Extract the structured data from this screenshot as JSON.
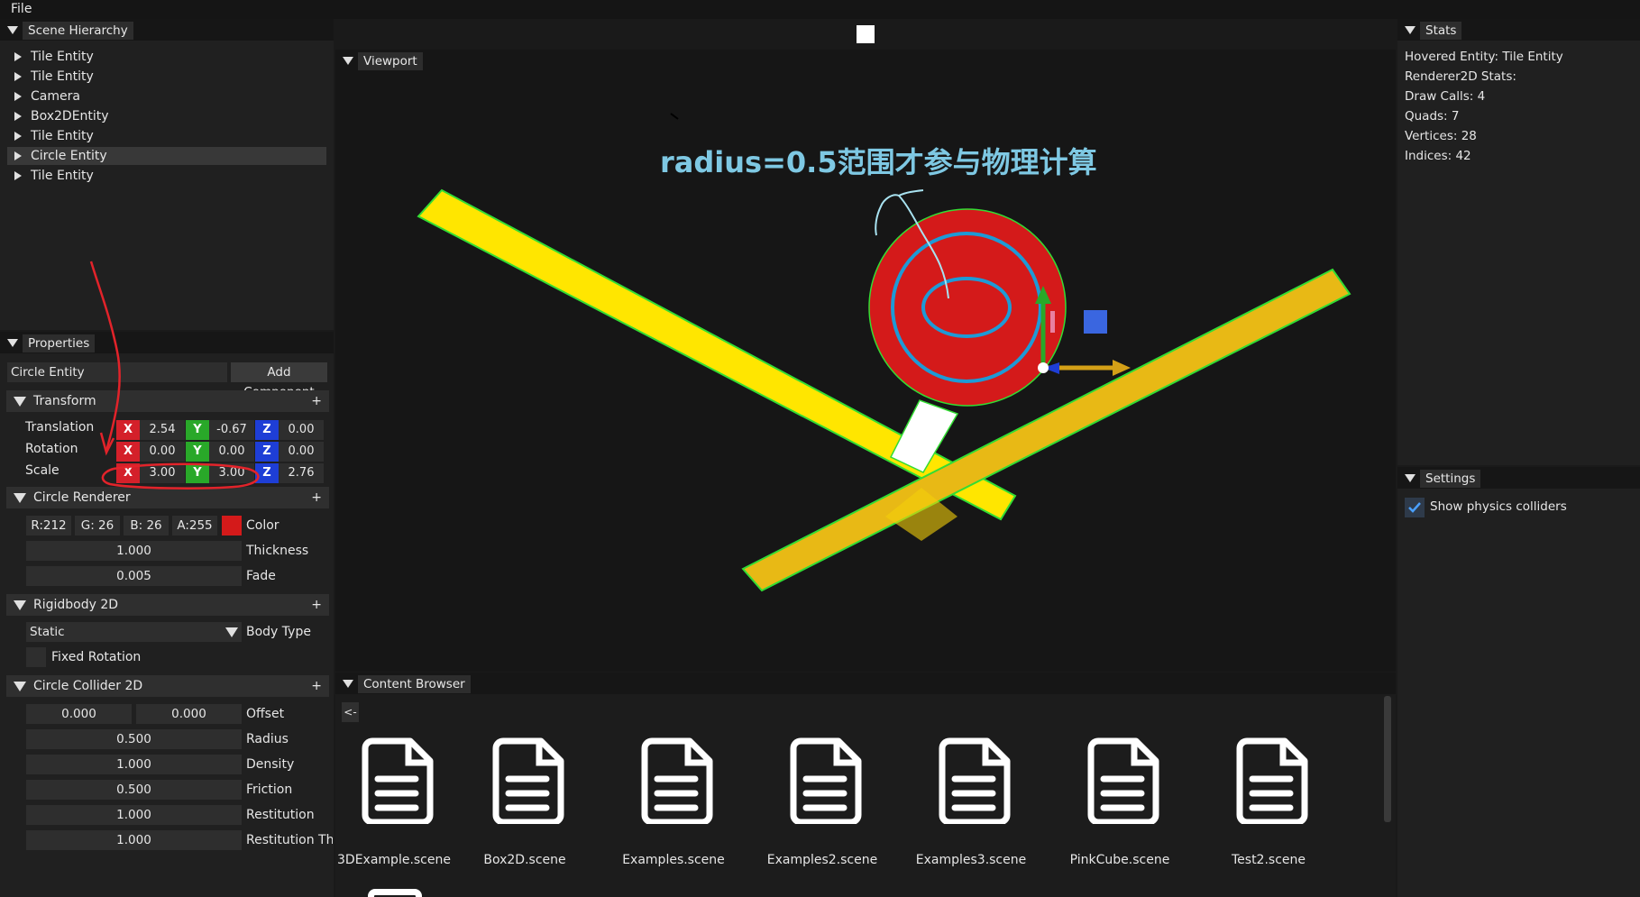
{
  "menu": {
    "file": "File"
  },
  "hierarchy": {
    "title": "Scene Hierarchy",
    "items": [
      {
        "label": "Tile Entity"
      },
      {
        "label": "Tile Entity"
      },
      {
        "label": "Camera"
      },
      {
        "label": "Box2DEntity"
      },
      {
        "label": "Tile Entity"
      },
      {
        "label": "Circle Entity"
      },
      {
        "label": "Tile Entity"
      }
    ],
    "selected_index": 5
  },
  "properties": {
    "title": "Properties",
    "entity_name": "Circle Entity",
    "add_component": "Add Component",
    "transform": {
      "title": "Transform",
      "plus": "+",
      "axes": {
        "x": "X",
        "y": "Y",
        "z": "Z"
      },
      "translation": {
        "label": "Translation",
        "x": "2.54",
        "y": "-0.67",
        "z": "0.00"
      },
      "rotation": {
        "label": "Rotation",
        "x": "0.00",
        "y": "0.00",
        "z": "0.00"
      },
      "scale": {
        "label": "Scale",
        "x": "3.00",
        "y": "3.00",
        "z": "2.76"
      }
    },
    "circle_renderer": {
      "title": "Circle Renderer",
      "plus": "+",
      "r": "R:212",
      "g": "G: 26",
      "b": "B: 26",
      "a": "A:255",
      "color_label": "Color",
      "color_hex": "#d41a1a",
      "thickness": "1.000",
      "thickness_label": "Thickness",
      "fade": "0.005",
      "fade_label": "Fade"
    },
    "rigidbody": {
      "title": "Rigidbody 2D",
      "plus": "+",
      "body_type": "Static",
      "body_type_label": "Body Type",
      "fixed_rotation_label": "Fixed Rotation"
    },
    "circle_collider": {
      "title": "Circle Collider 2D",
      "plus": "+",
      "offset_x": "0.000",
      "offset_y": "0.000",
      "offset_label": "Offset",
      "radius": "0.500",
      "radius_label": "Radius",
      "density": "1.000",
      "density_label": "Density",
      "friction": "0.500",
      "friction_label": "Friction",
      "restitution": "1.000",
      "restitution_label": "Restitution",
      "restitution_threshold": "1.000",
      "restitution_threshold_label": "Restitution Thre"
    }
  },
  "viewport": {
    "title": "Viewport",
    "annotation": "radius=0.5范围才参与物理计算"
  },
  "content_browser": {
    "title": "Content Browser",
    "back": "<-",
    "files": [
      {
        "name": "3DExample.scene"
      },
      {
        "name": "Box2D.scene"
      },
      {
        "name": "Examples.scene"
      },
      {
        "name": "Examples2.scene"
      },
      {
        "name": "Examples3.scene"
      },
      {
        "name": "PinkCube.scene"
      },
      {
        "name": "Test2.scene"
      }
    ]
  },
  "stats": {
    "title": "Stats",
    "hovered": "Hovered Entity: Tile Entity",
    "renderer": "Renderer2D Stats:",
    "draw_calls": "Draw Calls: 4",
    "quads": "Quads: 7",
    "vertices": "Vertices: 28",
    "indices": "Indices: 42"
  },
  "settings": {
    "title": "Settings",
    "show_colliders": "Show physics colliders",
    "show_colliders_checked": true
  },
  "colors": {
    "axis_x": "#d4202a",
    "axis_y": "#29a829",
    "axis_z": "#1e3ed6",
    "accent_annotation": "#7ec8e3"
  }
}
